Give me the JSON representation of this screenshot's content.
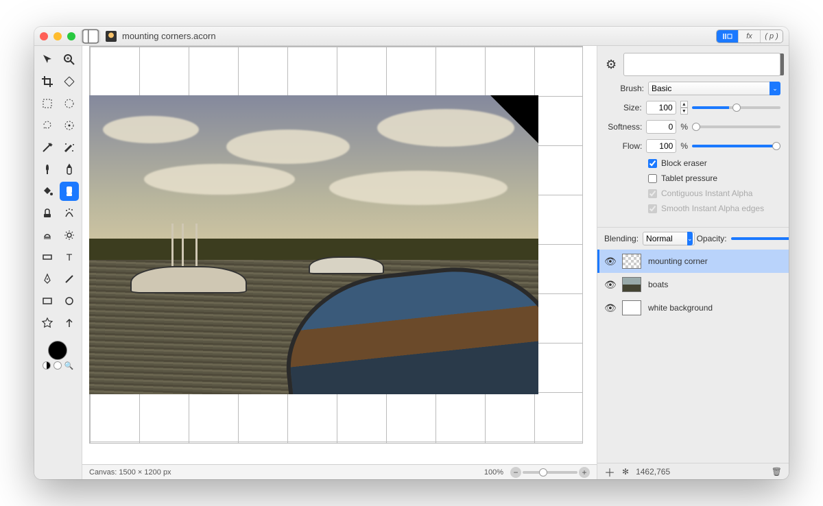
{
  "title": "mounting corners.acorn",
  "header_tabs": {
    "tools": "T",
    "fx": "fx",
    "p": "( p )"
  },
  "inspector": {
    "brush_label": "Brush:",
    "brush_value": "Basic",
    "size_label": "Size:",
    "size_value": "100",
    "softness_label": "Softness:",
    "softness_value": "0",
    "softness_unit": "%",
    "flow_label": "Flow:",
    "flow_value": "100",
    "flow_unit": "%",
    "block_eraser": "Block eraser",
    "tablet_pressure": "Tablet pressure",
    "contiguous_alpha": "Contiguous Instant Alpha",
    "smooth_alpha": "Smooth Instant Alpha edges"
  },
  "blending": {
    "label": "Blending:",
    "value": "Normal",
    "opacity_label": "Opacity:",
    "opacity_value": "100%"
  },
  "layers": [
    {
      "name": "mounting corner",
      "thumb": "checker",
      "selected": true
    },
    {
      "name": "boats",
      "thumb": "photo-th",
      "selected": false
    },
    {
      "name": "white background",
      "thumb": "white-th",
      "selected": false
    }
  ],
  "status": {
    "canvas": "Canvas: 1500 × 1200 px",
    "zoom": "100%",
    "coords": "1462,765"
  }
}
